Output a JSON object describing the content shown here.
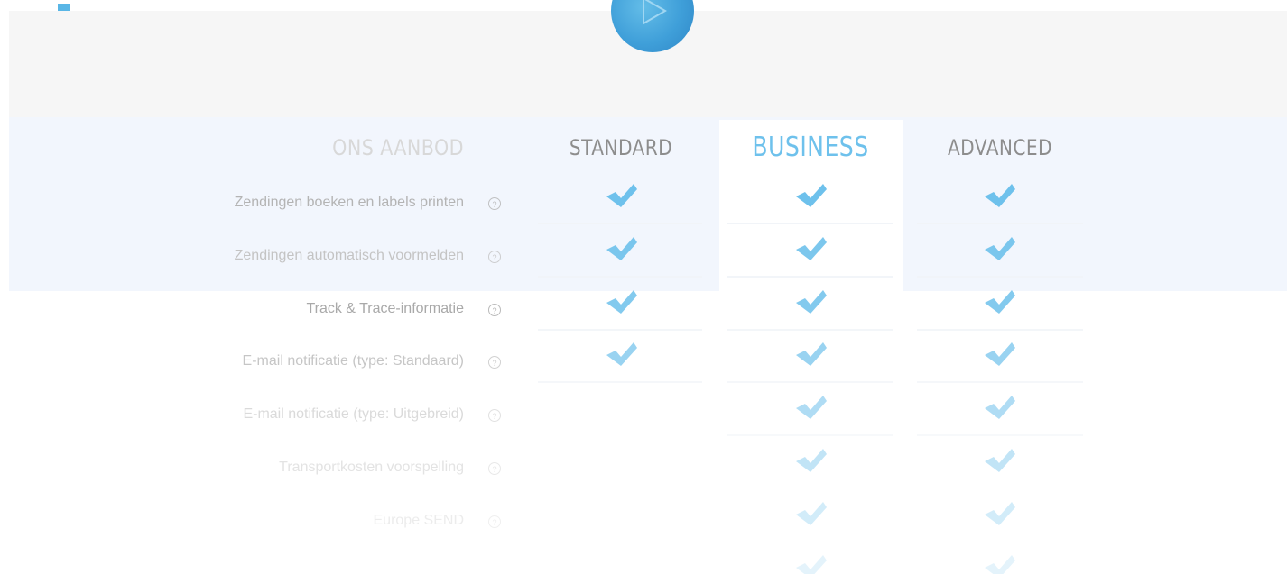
{
  "header": {
    "section_title": "ONS AANBOD",
    "plans": [
      "STANDARD",
      "BUSINESS",
      "ADVANCED"
    ],
    "play_icon": "play-icon"
  },
  "features": [
    {
      "label": "Zendingen boeken en labels printen",
      "standard": true,
      "business": true,
      "advanced": true
    },
    {
      "label": "Zendingen automatisch voormelden",
      "standard": true,
      "business": true,
      "advanced": true
    },
    {
      "label": "Track & Trace-informatie",
      "standard": true,
      "business": true,
      "advanced": true
    },
    {
      "label": "E-mail notificatie (type: Standaard)",
      "standard": true,
      "business": true,
      "advanced": true
    },
    {
      "label": "E-mail notificatie (type: Uitgebreid)",
      "standard": false,
      "business": true,
      "advanced": true
    },
    {
      "label": "Transportkosten voorspelling",
      "standard": false,
      "business": true,
      "advanced": true
    },
    {
      "label": "Europe SEND",
      "standard": false,
      "business": true,
      "advanced": true
    },
    {
      "label": "",
      "standard": false,
      "business": true,
      "advanced": true
    }
  ],
  "help_icon_text": "?",
  "colors": {
    "check": "#6ec1ec",
    "accent": "#6ec1ec",
    "band_gray": "#f6f6f6",
    "band_blue": "#f2f6fd"
  }
}
